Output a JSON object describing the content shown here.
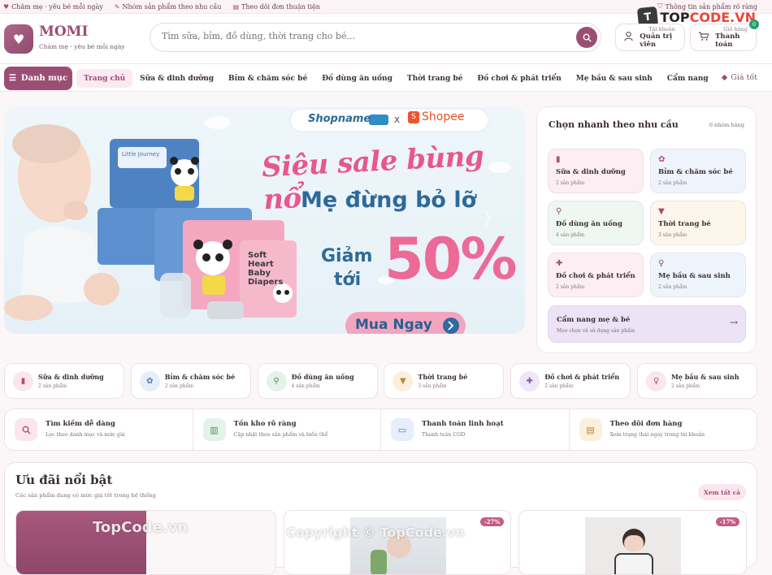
{
  "topbar": {
    "items": [
      "Chăm mẹ · yêu bé mỗi ngày",
      "Nhóm sản phẩm theo nhu cầu",
      "Theo dõi đơn thuận tiện"
    ],
    "right": "Thông tin sản phẩm rõ ràng"
  },
  "watermark_brand": {
    "prefix": "TOP",
    "suffix": "CODE.VN",
    "icon": "t-logo"
  },
  "brand": {
    "name": "MOMI",
    "tagline": "Chăm mẹ · yêu bé mỗi ngày",
    "logo_icon": "heart-icon"
  },
  "search": {
    "placeholder": "Tìm sữa, bỉm, đồ dùng, thời trang cho bé..."
  },
  "account": {
    "small": "Tài khoản",
    "main": "Quản trị viên"
  },
  "cart": {
    "small": "Giỏ hàng",
    "main": "Thanh toán",
    "count": "0"
  },
  "nav": {
    "menu_label": "Danh mục",
    "items": [
      "Trang chủ",
      "Sữa & dinh dưỡng",
      "Bỉm & chăm sóc bé",
      "Đồ dùng ăn uống",
      "Thời trang bé",
      "Đồ chơi & phát triển",
      "Mẹ bầu & sau sinh",
      "Cẩm nang"
    ],
    "right": "Giá tốt"
  },
  "banner": {
    "shop": "Shopname",
    "x": "x",
    "shopee": "Shopee",
    "headline": "Siêu sale bùng nổ",
    "sub": "Mẹ đừng bỏ lỡ",
    "giam": "Giảm",
    "toi": "tới",
    "percent": "50%",
    "cta": "Mua Ngay",
    "product_label": "Soft Heart Baby Diapers",
    "product_brand": "Little Journey"
  },
  "quick": {
    "title": "Chọn nhanh theo nhu cầu",
    "count": "6 nhóm hàng",
    "cards": [
      {
        "icon": "bottle-icon",
        "title": "Sữa & dinh dưỡng",
        "sub": "2 sản phẩm",
        "bg": "#fdeef3"
      },
      {
        "icon": "baby-icon",
        "title": "Bỉm & chăm sóc bé",
        "sub": "2 sản phẩm",
        "bg": "#eef3fc"
      },
      {
        "icon": "spoon-icon",
        "title": "Đồ dùng ăn uống",
        "sub": "4 sản phẩm",
        "bg": "#eef7f1"
      },
      {
        "icon": "shirt-icon",
        "title": "Thời trang bé",
        "sub": "3 sản phẩm",
        "bg": "#fdf6ea"
      },
      {
        "icon": "puzzle-icon",
        "title": "Đồ chơi & phát triển",
        "sub": "2 sản phẩm",
        "bg": "#fdeef3"
      },
      {
        "icon": "mother-icon",
        "title": "Mẹ bầu & sau sinh",
        "sub": "2 sản phẩm",
        "bg": "#eef4fb"
      }
    ],
    "wide": {
      "title": "Cẩm nang mẹ & bé",
      "sub": "Mẹo chọn và sử dụng sản phẩm"
    }
  },
  "categories": [
    {
      "icon": "bottle-icon",
      "title": "Sữa & dinh dưỡng",
      "sub": "2 sản phẩm",
      "bg": "#fbe6ee",
      "fg": "#b04f7a"
    },
    {
      "icon": "baby-icon",
      "title": "Bỉm & chăm sóc bé",
      "sub": "2 sản phẩm",
      "bg": "#e6eefb",
      "fg": "#5b76b4"
    },
    {
      "icon": "spoon-icon",
      "title": "Đồ dùng ăn uống",
      "sub": "4 sản phẩm",
      "bg": "#e4f3ea",
      "fg": "#4d8c66"
    },
    {
      "icon": "shirt-icon",
      "title": "Thời trang bé",
      "sub": "3 sản phẩm",
      "bg": "#fcf0dc",
      "fg": "#b2863c"
    },
    {
      "icon": "puzzle-icon",
      "title": "Đồ chơi & phát triển",
      "sub": "2 sản phẩm",
      "bg": "#efe6f8",
      "fg": "#7d5aa8"
    },
    {
      "icon": "mother-icon",
      "title": "Mẹ bầu & sau sinh",
      "sub": "2 sản phẩm",
      "bg": "#fbe6ee",
      "fg": "#b04f7a"
    }
  ],
  "features": [
    {
      "icon": "search-icon",
      "title": "Tìm kiếm dễ dàng",
      "sub": "Lọc theo danh mục và mức giá",
      "bg": "#fbe6ee",
      "fg": "#b04f7a"
    },
    {
      "icon": "stock-icon",
      "title": "Tồn kho rõ ràng",
      "sub": "Cập nhật theo sản phẩm và biến thể",
      "bg": "#e4f3ea",
      "fg": "#4d8c66"
    },
    {
      "icon": "card-icon",
      "title": "Thanh toán linh hoạt",
      "sub": "Thanh toán COD",
      "bg": "#e6eefb",
      "fg": "#5b76b4"
    },
    {
      "icon": "receipt-icon",
      "title": "Theo dõi đơn hàng",
      "sub": "Xem trạng thái ngay trong tài khoản",
      "bg": "#fcf0dc",
      "fg": "#b2863c"
    }
  ],
  "deals": {
    "title": "Ưu đãi nổi bật",
    "sub": "Các sản phẩm đang có mức giá tốt trong hệ thống",
    "see_all": "Xem tất cả",
    "badges": [
      "-27%",
      "-17%"
    ]
  },
  "overlay_watermarks": {
    "left": "TopCode.vn",
    "center": "Copyright © TopCode.vn"
  },
  "colors": {
    "brand": "#9b4e74",
    "accent": "#c15e85"
  }
}
